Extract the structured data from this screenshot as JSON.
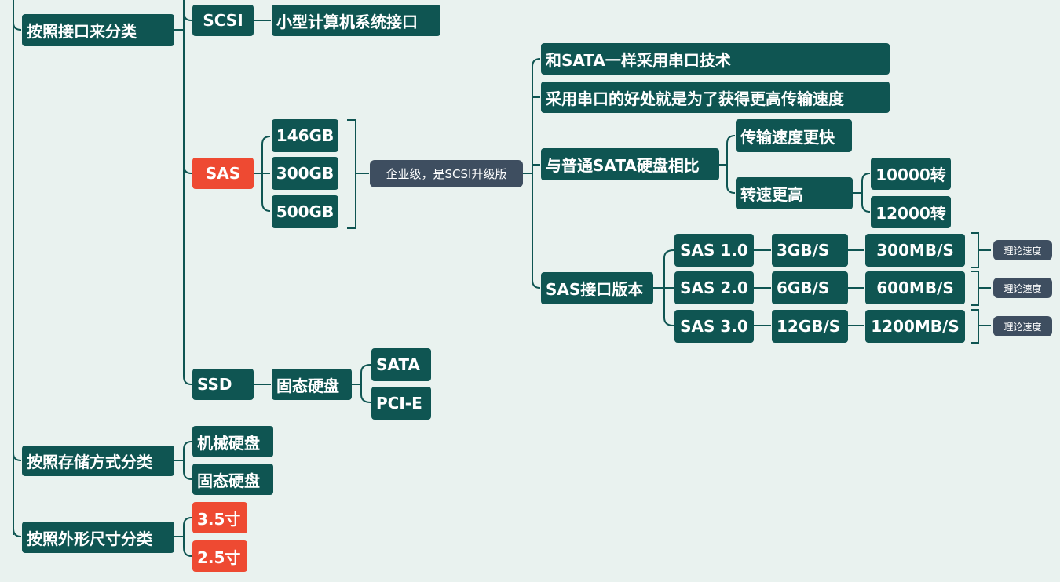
{
  "colors": {
    "background": "#e9f2ef",
    "node": "#0f5552",
    "highlight": "#ee4a32",
    "secondary": "#3e4e60",
    "line": "#0f5552"
  },
  "categories": {
    "interface": "按照接口来分类",
    "storage": "按照存储方式分类",
    "form_factor": "按照外形尺寸分类"
  },
  "scsi": {
    "label": "SCSI",
    "desc": "小型计算机系统接口"
  },
  "sas": {
    "label": "SAS",
    "capacities": [
      "146GB",
      "300GB",
      "500GB"
    ],
    "summary": "企业级，是SCSI升级版",
    "facts": [
      "和SATA一样采用串口技术",
      "采用串口的好处就是为了获得更高传输速度"
    ],
    "compare": {
      "label": "与普通SATA硬盘相比",
      "faster": "传输速度更快",
      "rpm_label": "转速更高",
      "rpm": [
        "10000转",
        "12000转"
      ]
    },
    "versions": {
      "label": "SAS接口版本",
      "rows": [
        {
          "name": "SAS 1.0",
          "gbps": "3GB/S",
          "mbps": "300MB/S",
          "note": "理论速度"
        },
        {
          "name": "SAS 2.0",
          "gbps": "6GB/S",
          "mbps": "600MB/S",
          "note": "理论速度"
        },
        {
          "name": "SAS 3.0",
          "gbps": "12GB/S",
          "mbps": "1200MB/S",
          "note": "理论速度"
        }
      ]
    }
  },
  "ssd": {
    "label": "SSD",
    "desc": "固态硬盘",
    "types": [
      "SATA",
      "PCI-E"
    ]
  },
  "storage_types": [
    "机械硬盘",
    "固态硬盘"
  ],
  "sizes": [
    "3.5寸",
    "2.5寸"
  ]
}
